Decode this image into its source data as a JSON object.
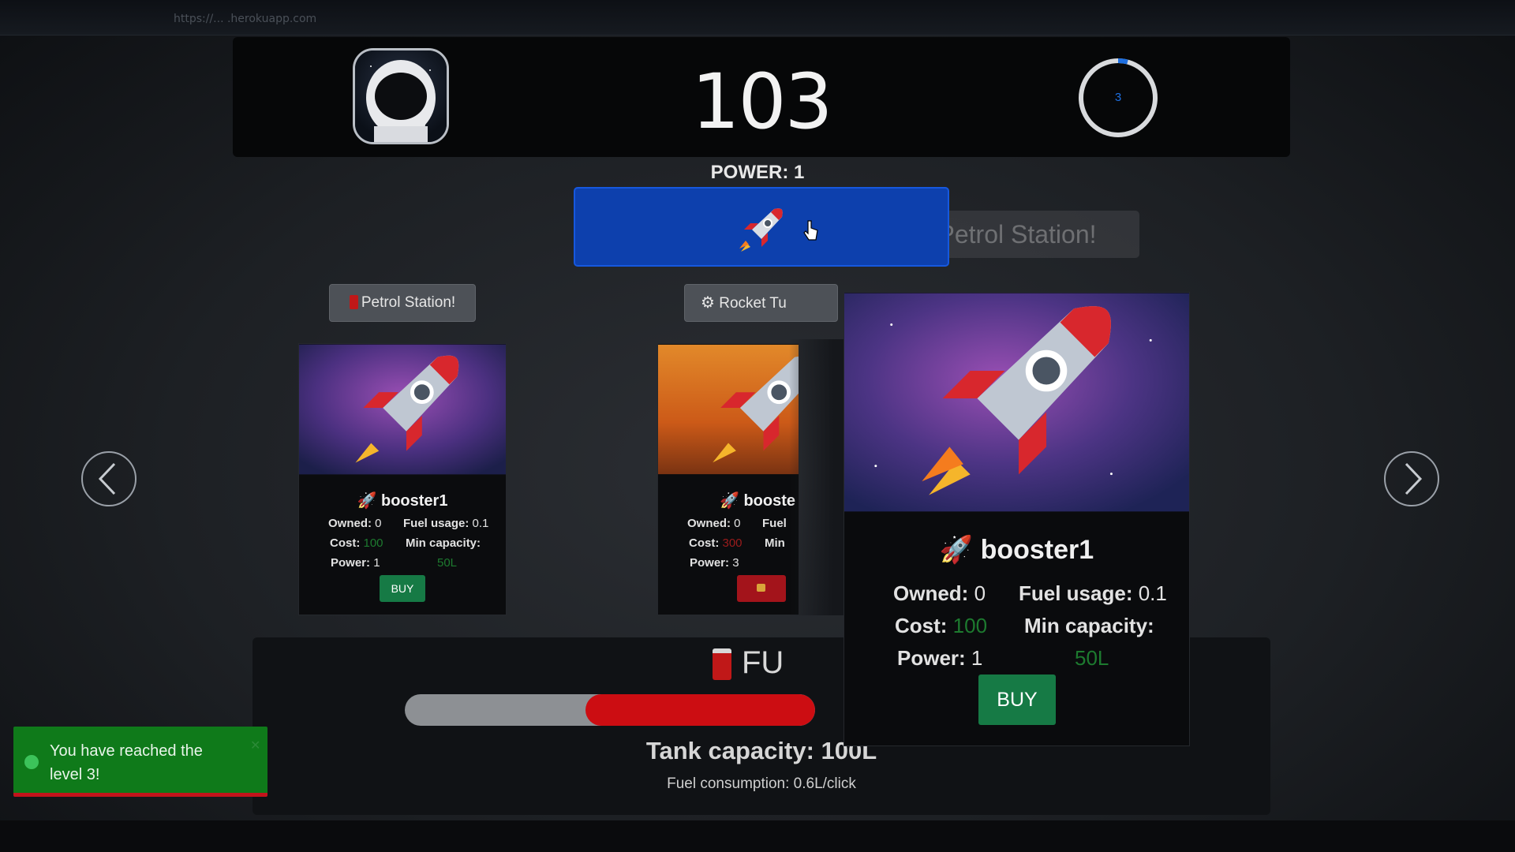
{
  "browser": {
    "url": "https://... .herokuapp.com"
  },
  "header": {
    "score": "103",
    "level": "3"
  },
  "power_label": "POWER: 1",
  "launch_button": {
    "icon": "rocket-icon"
  },
  "ghost_button": {
    "label": "Petrol Station!"
  },
  "tabs": [
    {
      "label": "Petrol Station!",
      "icon": "fuel-pump-icon"
    },
    {
      "label": "Rocket Tu",
      "icon": "gear-icon"
    }
  ],
  "cards": [
    {
      "name": "booster1",
      "owned_label": "Owned:",
      "owned": "0",
      "fuel_label": "Fuel usage:",
      "fuel": "0.1",
      "cost_label": "Cost:",
      "cost": "100",
      "min_label": "Min capacity:",
      "min": "50L",
      "power_label": "Power:",
      "power": "1",
      "buy_label": "BUY"
    },
    {
      "name": "booste",
      "owned_label": "Owned:",
      "owned": "0",
      "fuel_label": "Fuel",
      "cost_label": "Cost:",
      "cost": "300",
      "min_label": "Min",
      "power_label": "Power:",
      "power": "3"
    },
    {
      "name": "booster1",
      "owned_label": "Owned:",
      "owned": "0",
      "fuel_label": "Fuel usage:",
      "fuel": "0.1",
      "cost_label": "Cost:",
      "cost": "100",
      "min_label": "Min capacity:",
      "min": "50L",
      "power_label": "Power:",
      "power": "1",
      "buy_label": "BUY"
    }
  ],
  "fuel": {
    "title": "FU",
    "level_fraction": 0.56,
    "tank_capacity": "Tank capacity: 100L",
    "consumption": "Fuel consumption: 0.6L/click"
  },
  "toast": {
    "message": "You have reached the level 3!"
  },
  "colors": {
    "accent_blue": "#0d40ad",
    "buy_green": "#167a45",
    "fuel_red": "#cc0d12",
    "toast_green": "#0f7a1a"
  }
}
